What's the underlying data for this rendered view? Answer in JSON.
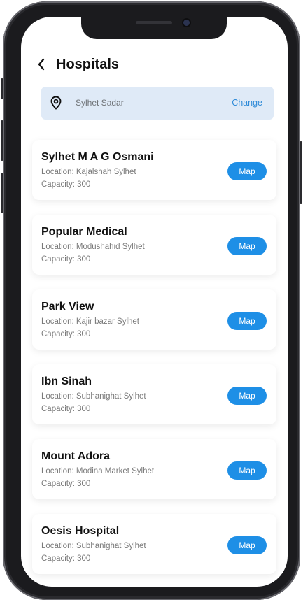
{
  "header": {
    "title": "Hospitals"
  },
  "location": {
    "value": "Sylhet Sadar",
    "change_label": "Change"
  },
  "hospitals": [
    {
      "name": "Sylhet M A G Osmani",
      "location": "Location: Kajalshah Sylhet",
      "capacity": "Capacity: 300",
      "button": "Map"
    },
    {
      "name": "Popular Medical",
      "location": "Location: Modushahid Sylhet",
      "capacity": "Capacity: 300",
      "button": "Map"
    },
    {
      "name": "Park View",
      "location": "Location: Kajir bazar Sylhet",
      "capacity": "Capacity: 300",
      "button": "Map"
    },
    {
      "name": "Ibn Sinah",
      "location": "Location: Subhanighat Sylhet",
      "capacity": "Capacity: 300",
      "button": "Map"
    },
    {
      "name": "Mount Adora",
      "location": "Location: Modina Market Sylhet",
      "capacity": "Capacity: 300",
      "button": "Map"
    },
    {
      "name": "Oesis Hospital",
      "location": "Location: Subhanighat Sylhet",
      "capacity": "Capacity: 300",
      "button": "Map"
    }
  ],
  "colors": {
    "accent": "#1e8fe6",
    "location_bar": "#dfeaf7",
    "change_link": "#2f8bd8"
  },
  "icons": {
    "back": "chevron-left-icon",
    "location": "map-pin-icon"
  }
}
